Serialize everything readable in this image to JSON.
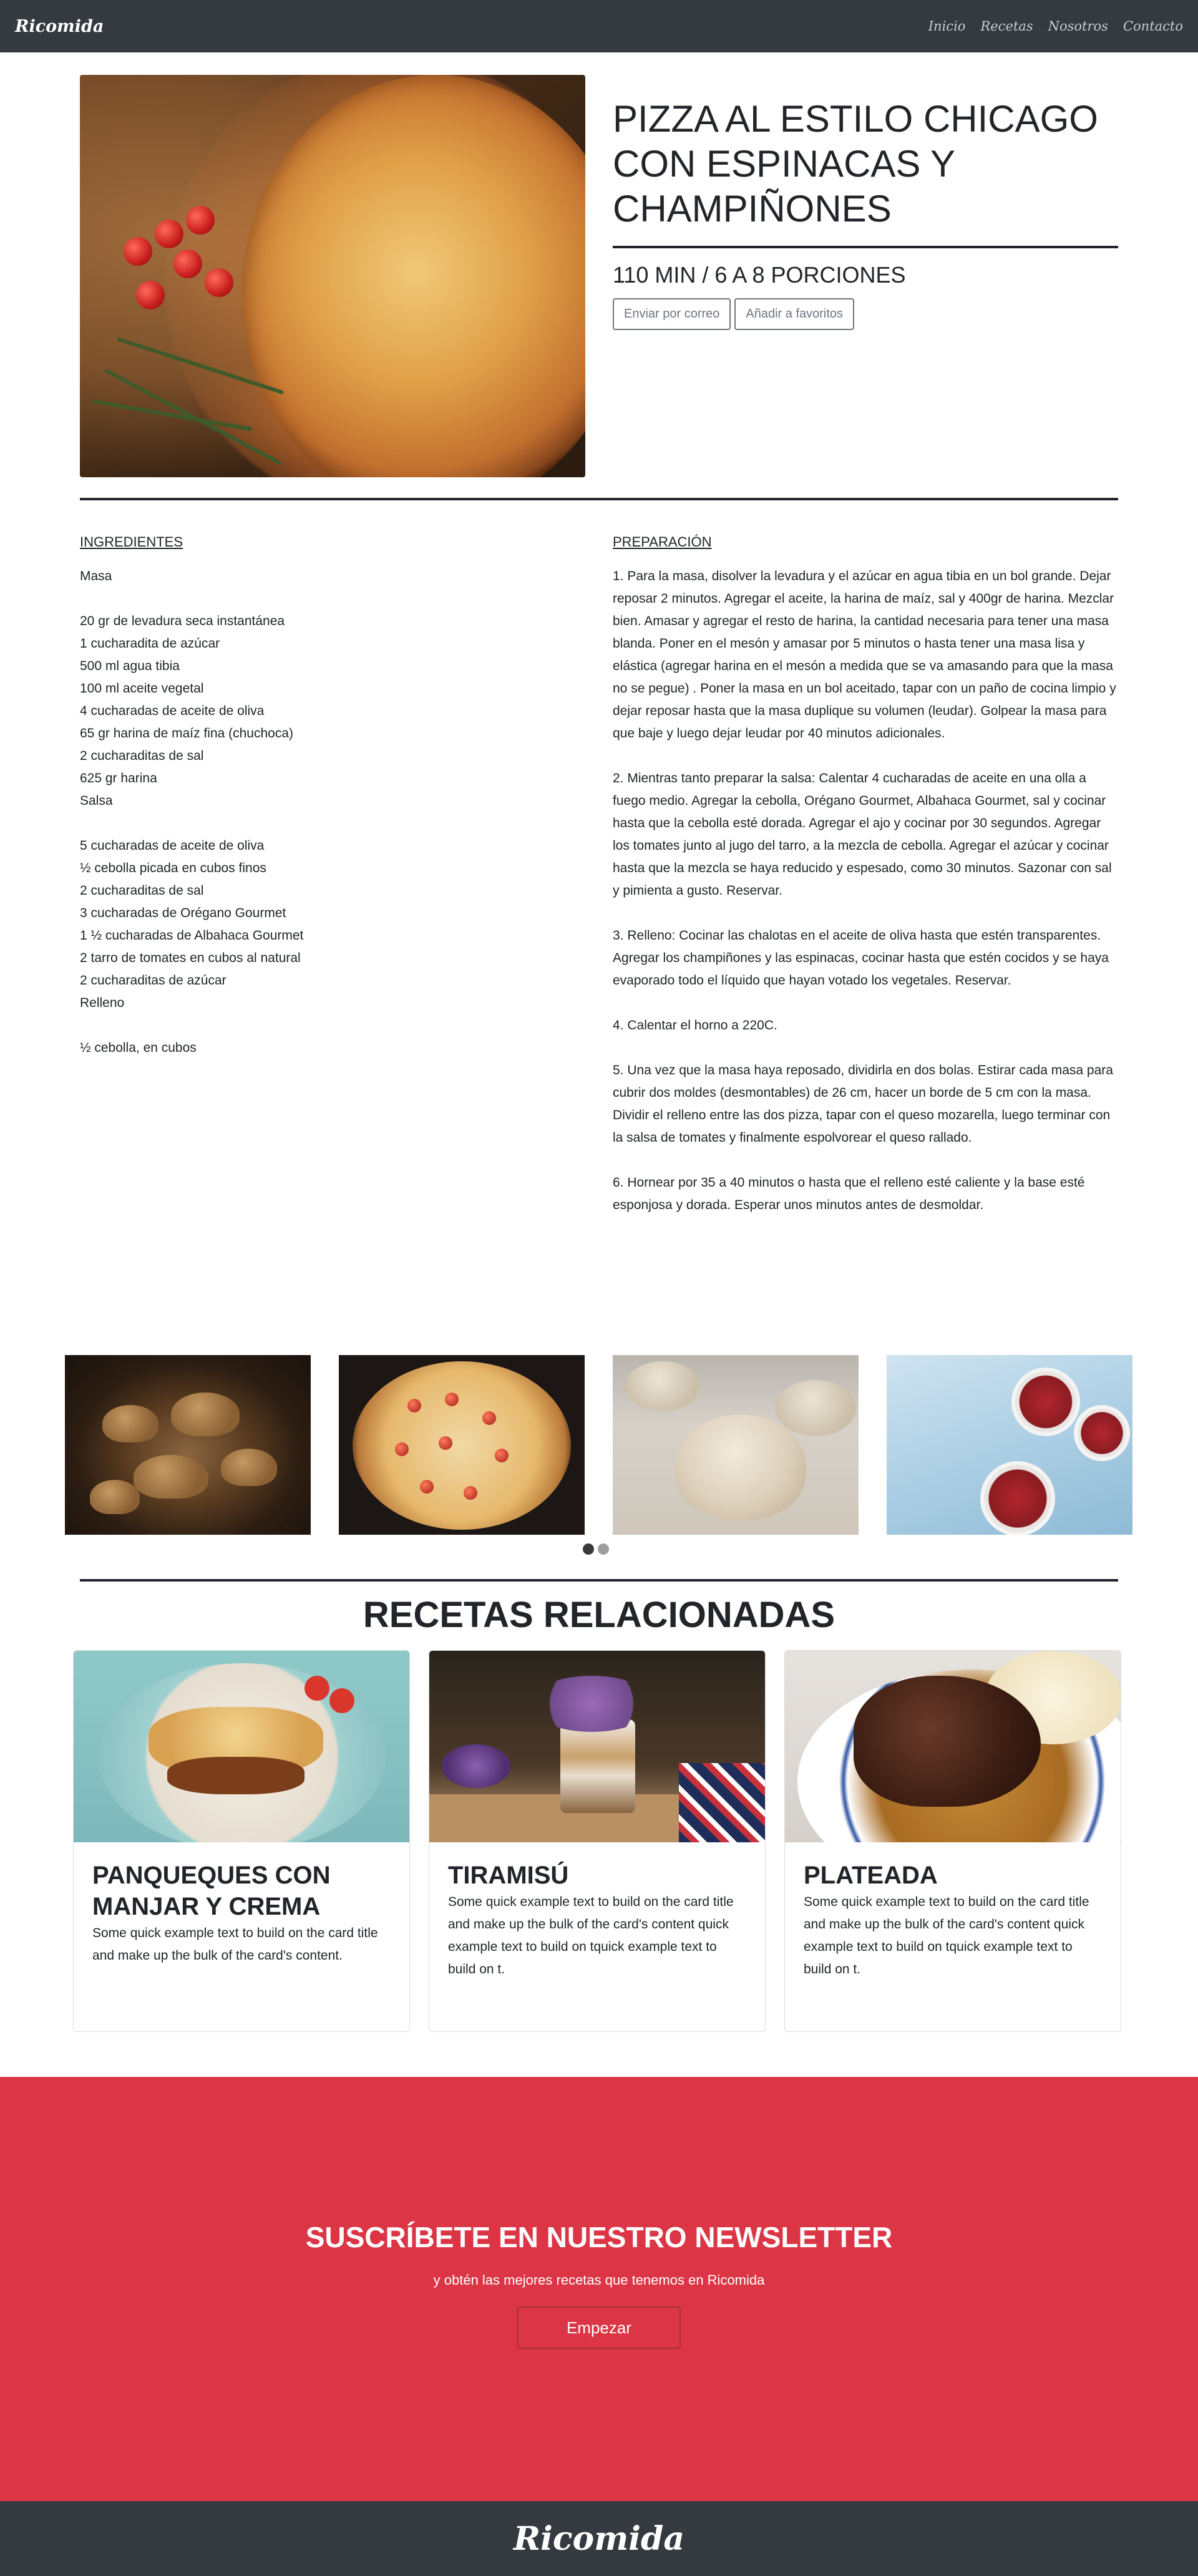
{
  "nav": {
    "brand": "Ricomida",
    "links": [
      "Inicio",
      "Recetas",
      "Nosotros",
      "Contacto"
    ]
  },
  "recipe": {
    "title": "Pizza al estilo Chicago con espinacas y champiñones",
    "meta": "110 min / 6 a 8 porciones",
    "email_button": "Enviar por correo",
    "favorite_button": "Añadir a favoritos",
    "hero_image": "chicago-pizza-photo"
  },
  "ingredients": {
    "heading": "Ingredientes",
    "text": "Masa\n\n20 gr de levadura seca instantánea\n1 cucharadita de azúcar\n500 ml agua tibia\n100 ml aceite vegetal\n4 cucharadas de aceite de oliva\n65 gr harina de maíz fina (chuchoca)\n2 cucharaditas de sal\n625 gr harina\nSalsa\n\n5 cucharadas de aceite de oliva\n½ cebolla picada en cubos finos\n2 cucharaditas de sal\n3 cucharadas de Orégano Gourmet\n1 ½ cucharadas de Albahaca Gourmet\n2 tarro de tomates en cubos al natural\n2 cucharaditas de azúcar\nRelleno\n\n½ cebolla, en cubos"
  },
  "preparation": {
    "heading": "Preparación",
    "steps": [
      "1. Para la masa, disolver la levadura y el azúcar en agua tibia en un bol grande. Dejar reposar 2 minutos. Agregar el aceite, la harina de maíz, sal y 400gr de harina. Mezclar bien. Amasar y agregar el resto de harina, la cantidad necesaria para tener una masa blanda. Poner en el mesón y amasar por 5 minutos o hasta tener una masa lisa y elástica (agregar harina en el mesón a medida que se va amasando para que la masa no se pegue) . Poner la masa en un bol aceitado, tapar con un paño de cocina limpio y dejar reposar hasta que la masa duplique su volumen (leudar). Golpear la masa para que baje y luego dejar leudar por 40 minutos adicionales.",
      "2. Mientras tanto preparar la salsa: Calentar 4 cucharadas de aceite en una olla a fuego medio. Agregar la cebolla, Orégano Gourmet, Albahaca Gourmet, sal y cocinar hasta que la cebolla esté dorada. Agregar el ajo y cocinar por 30 segundos. Agregar los tomates junto al jugo del tarro, a la mezcla de cebolla. Agregar el azúcar y cocinar hasta que la mezcla se haya reducido y espesado, como 30 minutos. Sazonar con sal y pimienta a gusto. Reservar.",
      "3. Relleno: Cocinar las chalotas en el aceite de oliva hasta que estén transparentes. Agregar los champiñones y las espinacas, cocinar hasta que estén cocidos y se haya evaporado todo el líquido que hayan votado los vegetales. Reservar.",
      "4. Calentar el horno a 220C.",
      "5. Una vez que la masa haya reposado, dividirla en dos bolas. Estirar cada masa para cubrir dos moldes (desmontables) de 26 cm, hacer un borde de 5 cm con la masa. Dividir el relleno entre las dos pizza, tapar con el queso mozarella, luego terminar con la salsa de tomates y finalmente espolvorear el queso rallado.",
      "6. Hornear por 35 a 40 minutos o hasta que el relleno esté caliente y la base esté esponjosa y dorada. Esperar unos minutos antes de desmoldar."
    ]
  },
  "gallery": {
    "images": [
      "mushrooms-photo",
      "pizza-oven-photo",
      "dough-photo",
      "pomegranate-photo"
    ],
    "dots": 2,
    "active_dot": 0
  },
  "related": {
    "heading": "Recetas relacionadas",
    "cards": [
      {
        "title": "Panqueques con manjar y crema",
        "text": "Some quick example text to build on the card title and make up the bulk of the card's content.",
        "image": "crepes-photo"
      },
      {
        "title": "Tiramisú",
        "text": "Some quick example text to build on the card title and make up the bulk of the card's content quick example text to build on tquick example text to build on t.",
        "image": "tiramisu-photo"
      },
      {
        "title": "Plateada",
        "text": "Some quick example text to build on the card title and make up the bulk of the card's content quick example text to build on tquick example text to build on t.",
        "image": "braised-beef-photo"
      }
    ]
  },
  "newsletter": {
    "title": "Suscríbete en nuestro newsletter",
    "subtitle": "y obtén las mejores recetas que tenemos en Ricomida",
    "button": "Empezar",
    "background_color": "#dc3545"
  },
  "footer": {
    "brand": "Ricomida"
  }
}
